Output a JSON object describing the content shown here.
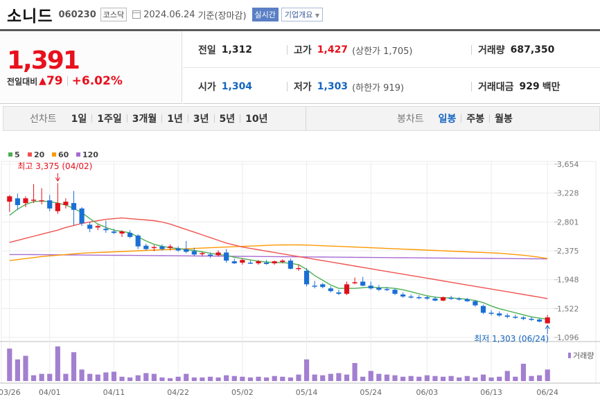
{
  "header": {
    "name": "소니드",
    "code": "060230",
    "market": "코스닥",
    "date": "2024.06.24",
    "basis": "기준(장마감)",
    "realtime_label": "실시간",
    "corp_label": "기업개요"
  },
  "price": {
    "current": "1,391",
    "diff_label": "전일대비",
    "diff_value": "79",
    "diff_rate": "+6.02%"
  },
  "stats": {
    "prev_close_label": "전일",
    "prev_close": "1,312",
    "high_label": "고가",
    "high": "1,427",
    "upper_limit": "(상한가 1,705)",
    "volume_label": "거래량",
    "volume": "687,350",
    "open_label": "시가",
    "open": "1,304",
    "low_label": "저가",
    "low": "1,303",
    "lower_limit": "(하한가 919)",
    "amount_label": "거래대금",
    "amount": "929",
    "amount_unit": "백만"
  },
  "tabs": {
    "line_label": "선차트",
    "line_items": [
      "1일",
      "1주일",
      "3개월",
      "1년",
      "3년",
      "5년",
      "10년"
    ],
    "candle_label": "봉차트",
    "candle_items": [
      "일봉",
      "주봉",
      "월봉"
    ],
    "candle_selected": "일봉"
  },
  "chart_data": {
    "type": "candlestick",
    "legend": [
      {
        "name": "5",
        "color": "#4caf50"
      },
      {
        "name": "20",
        "color": "#ef5350"
      },
      {
        "name": "60",
        "color": "#ff9800"
      },
      {
        "name": "120",
        "color": "#a66bd3"
      }
    ],
    "y_ticks": [
      3654,
      3228,
      2801,
      2375,
      1948,
      1522,
      1096
    ],
    "ylim": [
      1096,
      3654
    ],
    "x_tick_labels": [
      "03/26",
      "04/01",
      "04/11",
      "04/22",
      "05/02",
      "05/14",
      "05/24",
      "06/03",
      "06/13",
      "06/24"
    ],
    "x_tick_index": [
      0,
      5,
      13,
      21,
      29,
      37,
      45,
      52,
      60,
      67
    ],
    "high_annotation": "최고 3,375 (04/02)",
    "high_point": {
      "index": 6,
      "value": 3375
    },
    "low_annotation": "최저 1,303 (06/24)",
    "low_point": {
      "index": 67,
      "value": 1303
    },
    "volume_label": "거래량",
    "up_color": "#e0101c",
    "down_color": "#1a6fd4",
    "ohlc": [
      [
        3100,
        3200,
        2950,
        3180
      ],
      [
        3150,
        3220,
        2980,
        3050
      ],
      [
        3080,
        3180,
        3020,
        3150
      ],
      [
        3120,
        3360,
        3080,
        3130
      ],
      [
        3110,
        3300,
        3060,
        3120
      ],
      [
        3120,
        3200,
        2960,
        3000
      ],
      [
        2960,
        3375,
        2920,
        3080
      ],
      [
        3050,
        3150,
        3000,
        3100
      ],
      [
        3080,
        3260,
        2750,
        2980
      ],
      [
        3000,
        3020,
        2740,
        2780
      ],
      [
        2760,
        2800,
        2650,
        2700
      ],
      [
        2720,
        2760,
        2680,
        2740
      ],
      [
        2700,
        2820,
        2640,
        2680
      ],
      [
        2660,
        2700,
        2620,
        2640
      ],
      [
        2630,
        2680,
        2580,
        2660
      ],
      [
        2640,
        2680,
        2560,
        2580
      ],
      [
        2600,
        2620,
        2400,
        2440
      ],
      [
        2450,
        2480,
        2380,
        2400
      ],
      [
        2420,
        2460,
        2370,
        2430
      ],
      [
        2440,
        2470,
        2380,
        2400
      ],
      [
        2420,
        2470,
        2380,
        2440
      ],
      [
        2410,
        2440,
        2360,
        2380
      ],
      [
        2400,
        2520,
        2340,
        2360
      ],
      [
        2370,
        2420,
        2300,
        2320
      ],
      [
        2330,
        2360,
        2290,
        2340
      ],
      [
        2320,
        2350,
        2270,
        2300
      ],
      [
        2310,
        2380,
        2290,
        2350
      ],
      [
        2350,
        2400,
        2200,
        2230
      ],
      [
        2220,
        2260,
        2180,
        2190
      ],
      [
        2200,
        2260,
        2170,
        2240
      ],
      [
        2200,
        2230,
        2180,
        2190
      ],
      [
        2190,
        2240,
        2170,
        2220
      ],
      [
        2200,
        2240,
        2170,
        2180
      ],
      [
        2190,
        2230,
        2170,
        2220
      ],
      [
        2210,
        2250,
        2190,
        2230
      ],
      [
        2230,
        2260,
        2100,
        2110
      ],
      [
        2110,
        2170,
        2080,
        2120
      ],
      [
        2080,
        2120,
        1850,
        1880
      ],
      [
        1860,
        1930,
        1820,
        1850
      ],
      [
        1880,
        1900,
        1820,
        1840
      ],
      [
        1820,
        1850,
        1760,
        1780
      ],
      [
        1760,
        1800,
        1720,
        1740
      ],
      [
        1740,
        1920,
        1720,
        1880
      ],
      [
        1900,
        1980,
        1880,
        1910
      ],
      [
        1920,
        1990,
        1850,
        1860
      ],
      [
        1860,
        1920,
        1800,
        1820
      ],
      [
        1830,
        1870,
        1780,
        1800
      ],
      [
        1810,
        1840,
        1780,
        1800
      ],
      [
        1800,
        1820,
        1720,
        1740
      ],
      [
        1730,
        1760,
        1680,
        1700
      ],
      [
        1700,
        1730,
        1670,
        1690
      ],
      [
        1690,
        1720,
        1660,
        1680
      ],
      [
        1690,
        1710,
        1650,
        1670
      ],
      [
        1670,
        1700,
        1630,
        1640
      ],
      [
        1640,
        1700,
        1630,
        1690
      ],
      [
        1680,
        1710,
        1650,
        1670
      ],
      [
        1670,
        1690,
        1640,
        1660
      ],
      [
        1660,
        1680,
        1620,
        1630
      ],
      [
        1630,
        1650,
        1550,
        1570
      ],
      [
        1560,
        1580,
        1440,
        1460
      ],
      [
        1460,
        1500,
        1420,
        1450
      ],
      [
        1450,
        1480,
        1400,
        1420
      ],
      [
        1420,
        1450,
        1380,
        1400
      ],
      [
        1400,
        1430,
        1370,
        1390
      ],
      [
        1390,
        1410,
        1350,
        1370
      ],
      [
        1370,
        1400,
        1340,
        1360
      ],
      [
        1360,
        1380,
        1320,
        1330
      ],
      [
        1304,
        1427,
        1303,
        1391
      ]
    ],
    "ma5": [
      2900,
      2990,
      3060,
      3100,
      3110,
      3100,
      3080,
      3050,
      3000,
      2940,
      2850,
      2770,
      2720,
      2680,
      2660,
      2640,
      2580,
      2520,
      2470,
      2440,
      2420,
      2410,
      2390,
      2380,
      2360,
      2340,
      2320,
      2310,
      2280,
      2260,
      2240,
      2220,
      2210,
      2200,
      2200,
      2190,
      2170,
      2100,
      2010,
      1940,
      1870,
      1820,
      1820,
      1820,
      1830,
      1840,
      1830,
      1830,
      1820,
      1800,
      1770,
      1740,
      1710,
      1690,
      1680,
      1680,
      1670,
      1660,
      1640,
      1610,
      1560,
      1520,
      1490,
      1460,
      1430,
      1400,
      1380,
      1365
    ],
    "ma20": [
      2500,
      2530,
      2560,
      2590,
      2620,
      2650,
      2680,
      2720,
      2750,
      2780,
      2800,
      2820,
      2840,
      2850,
      2860,
      2850,
      2840,
      2830,
      2820,
      2800,
      2770,
      2730,
      2690,
      2650,
      2610,
      2570,
      2530,
      2490,
      2460,
      2430,
      2410,
      2390,
      2370,
      2350,
      2330,
      2310,
      2290,
      2270,
      2250,
      2230,
      2210,
      2190,
      2170,
      2150,
      2130,
      2110,
      2090,
      2070,
      2050,
      2030,
      2010,
      1990,
      1970,
      1950,
      1930,
      1910,
      1890,
      1870,
      1850,
      1830,
      1810,
      1790,
      1770,
      1750,
      1730,
      1710,
      1690,
      1670
    ],
    "ma60": [
      2230,
      2245,
      2260,
      2275,
      2290,
      2300,
      2310,
      2320,
      2330,
      2340,
      2345,
      2350,
      2355,
      2360,
      2365,
      2370,
      2375,
      2380,
      2385,
      2390,
      2395,
      2400,
      2405,
      2410,
      2415,
      2420,
      2425,
      2430,
      2435,
      2440,
      2445,
      2450,
      2455,
      2460,
      2462,
      2463,
      2462,
      2460,
      2455,
      2450,
      2445,
      2440,
      2435,
      2430,
      2425,
      2420,
      2415,
      2410,
      2405,
      2400,
      2395,
      2390,
      2385,
      2380,
      2375,
      2370,
      2365,
      2360,
      2355,
      2350,
      2345,
      2340,
      2330,
      2320,
      2310,
      2295,
      2280,
      2260
    ],
    "ma120": [
      2320,
      2320,
      2320,
      2319,
      2318,
      2317,
      2316,
      2315,
      2314,
      2313,
      2312,
      2311,
      2310,
      2309,
      2308,
      2307,
      2306,
      2305,
      2304,
      2303,
      2302,
      2301,
      2300,
      2299,
      2298,
      2297,
      2296,
      2295,
      2294,
      2293,
      2292,
      2291,
      2290,
      2289,
      2288,
      2287,
      2286,
      2285,
      2284,
      2283,
      2282,
      2281,
      2280,
      2279,
      2278,
      2277,
      2276,
      2275,
      2274,
      2273,
      2272,
      2271,
      2270,
      2269,
      2268,
      2267,
      2266,
      2265,
      2264,
      2263,
      2262,
      2261,
      2260,
      2259,
      2258,
      2257,
      2256,
      2255
    ],
    "volume": [
      45,
      30,
      35,
      8,
      10,
      10,
      48,
      10,
      40,
      16,
      10,
      9,
      12,
      13,
      6,
      5,
      8,
      11,
      10,
      5,
      4,
      6,
      10,
      5,
      5,
      6,
      5,
      8,
      7,
      6,
      5,
      6,
      5,
      7,
      6,
      5,
      9,
      30,
      9,
      8,
      10,
      11,
      9,
      25,
      6,
      14,
      10,
      9,
      8,
      6,
      7,
      6,
      8,
      7,
      6,
      7,
      5,
      7,
      5,
      9,
      5,
      6,
      14,
      6,
      24,
      7,
      8,
      16
    ]
  }
}
